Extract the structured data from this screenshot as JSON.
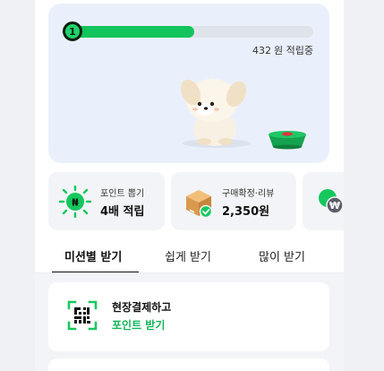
{
  "hero": {
    "level": "1",
    "progress": 0.52,
    "points_value": "432",
    "points_unit": "원 적립중"
  },
  "cards": [
    {
      "title": "포인트 뽑기",
      "value": "4배 적립",
      "icon": "point-badge-icon"
    },
    {
      "title": "구매확정·리뷰",
      "value": "2,350원",
      "icon": "package-check-icon"
    },
    {
      "icon": "won-coin-icon"
    }
  ],
  "tabs": [
    {
      "label": "미션별 받기",
      "active": true
    },
    {
      "label": "쉽게 받기"
    },
    {
      "label": "많이 받기"
    }
  ],
  "missions": [
    {
      "title": "현장결제하고",
      "link": "포인트 받기",
      "icon": "qr-code-icon"
    }
  ],
  "colors": {
    "accent": "#11c45c",
    "link": "#0fb659",
    "background": "#f0f1f4"
  }
}
